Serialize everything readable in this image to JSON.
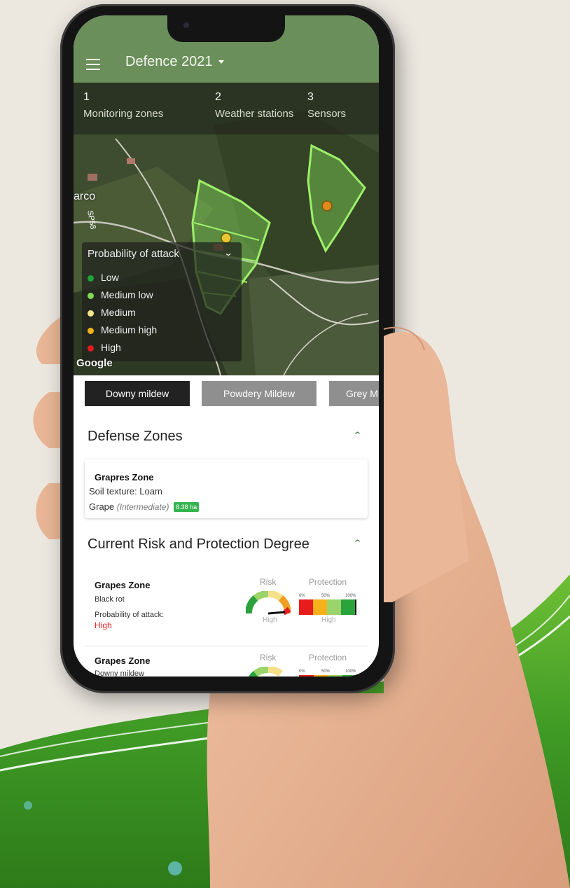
{
  "app": {
    "title": "Defence 2021"
  },
  "stats": [
    {
      "number": "1",
      "label": "Monitoring zones"
    },
    {
      "number": "2",
      "label": "Weather stations"
    },
    {
      "number": "3",
      "label": "Sensors"
    }
  ],
  "map": {
    "place_label": "arco",
    "road_label": "SP58",
    "attribution": "Google"
  },
  "legend": {
    "title": "Probability of attack",
    "items": [
      {
        "label": "Low",
        "color": "#1fa33a"
      },
      {
        "label": "Medium low",
        "color": "#7ed957"
      },
      {
        "label": "Medium",
        "color": "#f5e58a"
      },
      {
        "label": "Medium high",
        "color": "#f0b21a"
      },
      {
        "label": "High",
        "color": "#e01b1b"
      }
    ]
  },
  "disease_tabs": [
    {
      "label": "Downy mildew",
      "selected": true
    },
    {
      "label": "Powdery Mildew",
      "selected": false
    },
    {
      "label": "Grey M",
      "selected": false
    }
  ],
  "defense_zones": {
    "title": "Defense Zones",
    "zone": {
      "name": "Grapres Zone",
      "soil": "Soil texture: Loam",
      "crop": "Grape",
      "variety": "(Intermediate)",
      "area": "8.38 ha"
    }
  },
  "risk_section": {
    "title": "Current Risk and Protection Degree",
    "risk_header": "Risk",
    "protection_header": "Protection",
    "protection_ticks": [
      "0%",
      "50%",
      "100%"
    ],
    "rows": [
      {
        "zone": "Grapes Zone",
        "disease": "Black rot",
        "probability_label": "Probability of attack:",
        "level": "High",
        "risk_level": "High",
        "protection_level": "High"
      },
      {
        "zone": "Grapes Zone",
        "disease": "Downy mildew"
      }
    ]
  },
  "colors": {
    "appbar": "#6b8f5b",
    "accent": "#34b34e",
    "high": "#e22222"
  }
}
